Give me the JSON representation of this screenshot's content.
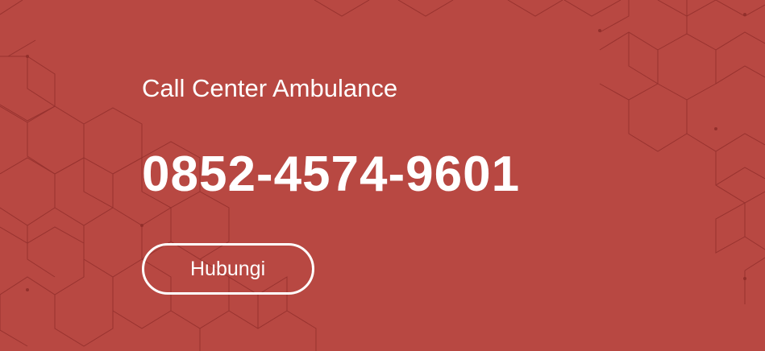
{
  "banner": {
    "title": "Call Center Ambulance",
    "phone": "0852-4574-9601",
    "button_label": "Hubungi"
  },
  "colors": {
    "background": "#b84842",
    "pattern_line": "#8f2d2a",
    "text": "#ffffff"
  },
  "decoration": {
    "pattern": "isometric-cube-lines"
  }
}
